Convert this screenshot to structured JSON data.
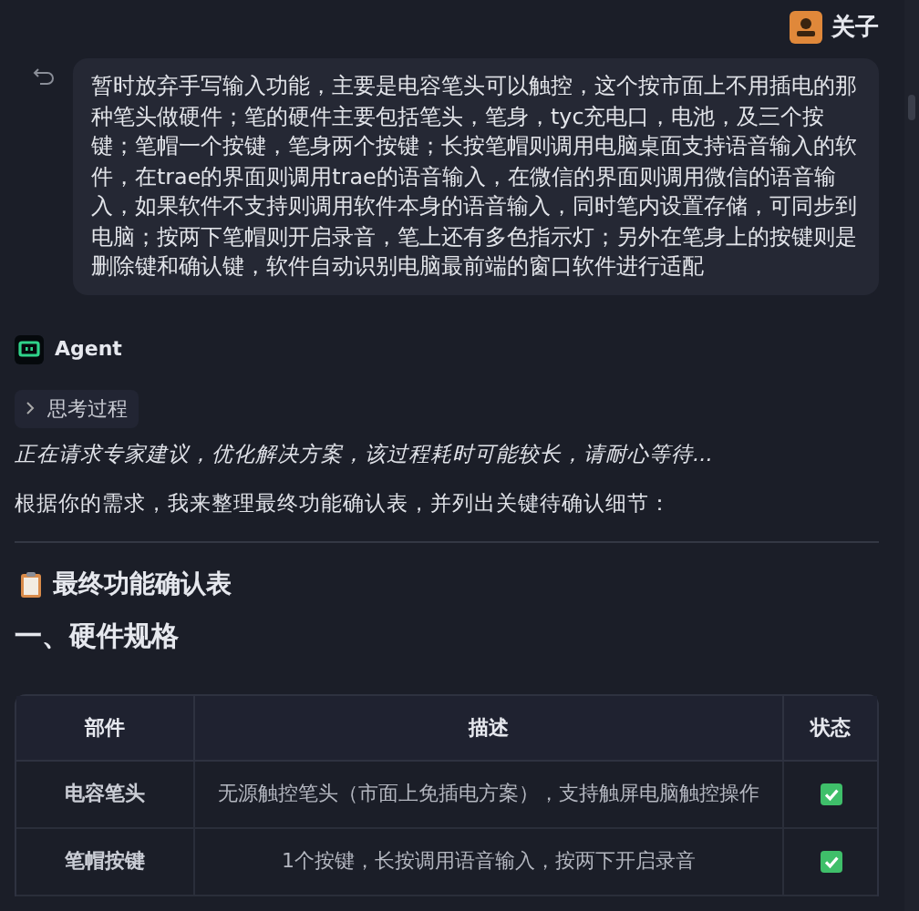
{
  "user": {
    "name": "关子"
  },
  "message": {
    "text": "暂时放弃手写输入功能，主要是电容笔头可以触控，这个按市面上不用插电的那种笔头做硬件；笔的硬件主要包括笔头，笔身，tyc充电口，电池，及三个按键；笔帽一个按键，笔身两个按键；长按笔帽则调用电脑桌面支持语音输入的软件，在trae的界面则调用trae的语音输入，在微信的界面则调用微信的语音输入，如果软件不支持则调用软件本身的语音输入，同时笔内设置存储，可同步到电脑；按两下笔帽则开启录音，笔上还有多色指示灯；另外在笔身上的按键则是删除键和确认键，软件自动识别电脑最前端的窗口软件进行适配"
  },
  "agent": {
    "name": "Agent",
    "thinking": {
      "label": "思考过程",
      "expanded": false
    },
    "status": "正在请求专家建议，优化解决方案，该过程耗时可能较长，请耐心等待...",
    "intro": "根据你的需求，我来整理最终功能确认表，并列出关键待确认细节：",
    "title": "最终功能确认表",
    "section": "一、硬件规格"
  },
  "table": {
    "columns": [
      "部件",
      "描述",
      "状态"
    ],
    "rows": [
      {
        "part": "电容笔头",
        "description": "无源触控笔头（市面上免插电方案），支持触屏电脑触控操作",
        "checked": true
      },
      {
        "part": "笔帽按键",
        "description": "1个按键，长按调用语音输入，按两下开启录音",
        "checked": true
      }
    ]
  }
}
